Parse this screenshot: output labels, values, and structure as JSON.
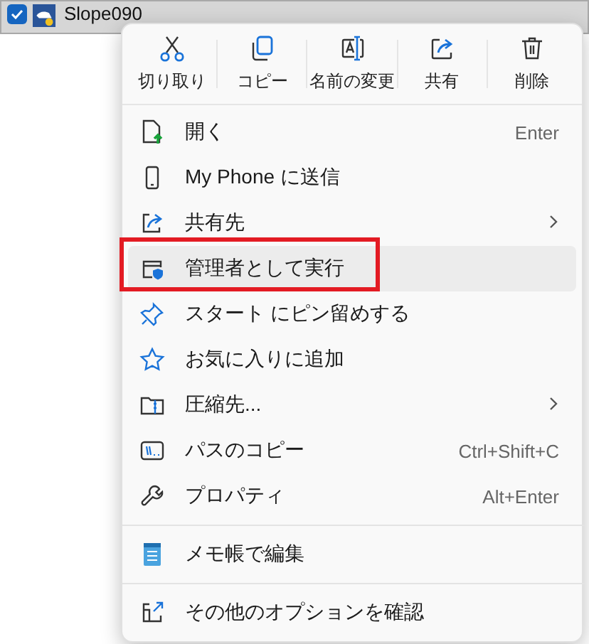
{
  "file_row": {
    "checked": true,
    "name": "Slope090"
  },
  "context_menu": {
    "toolbar": [
      {
        "label": "切り取り"
      },
      {
        "label": "コピー"
      },
      {
        "label": "名前の変更"
      },
      {
        "label": "共有"
      },
      {
        "label": "削除"
      }
    ],
    "items": [
      {
        "kind": "item",
        "label": "開く",
        "shortcut": "Enter",
        "submenu": false,
        "hovered": false,
        "outlined": false
      },
      {
        "kind": "item",
        "label": "My Phone に送信",
        "submenu": false,
        "hovered": false,
        "outlined": false
      },
      {
        "kind": "item",
        "label": "共有先",
        "submenu": true,
        "hovered": false,
        "outlined": false
      },
      {
        "kind": "item",
        "label": "管理者として実行",
        "submenu": false,
        "hovered": true,
        "outlined": true
      },
      {
        "kind": "item",
        "label": "スタート にピン留めする",
        "submenu": false,
        "hovered": false,
        "outlined": false
      },
      {
        "kind": "item",
        "label": "お気に入りに追加",
        "submenu": false,
        "hovered": false,
        "outlined": false
      },
      {
        "kind": "item",
        "label": "圧縮先...",
        "submenu": true,
        "hovered": false,
        "outlined": false
      },
      {
        "kind": "item",
        "label": "パスのコピー",
        "shortcut": "Ctrl+Shift+C",
        "submenu": false,
        "hovered": false,
        "outlined": false
      },
      {
        "kind": "item",
        "label": "プロパティ",
        "shortcut": "Alt+Enter",
        "submenu": false,
        "hovered": false,
        "outlined": false
      },
      {
        "kind": "separator"
      },
      {
        "kind": "item",
        "label": "メモ帳で編集",
        "submenu": false,
        "hovered": false,
        "outlined": false
      },
      {
        "kind": "separator"
      },
      {
        "kind": "item",
        "label": "その他のオプションを確認",
        "submenu": false,
        "hovered": false,
        "outlined": false
      }
    ]
  }
}
